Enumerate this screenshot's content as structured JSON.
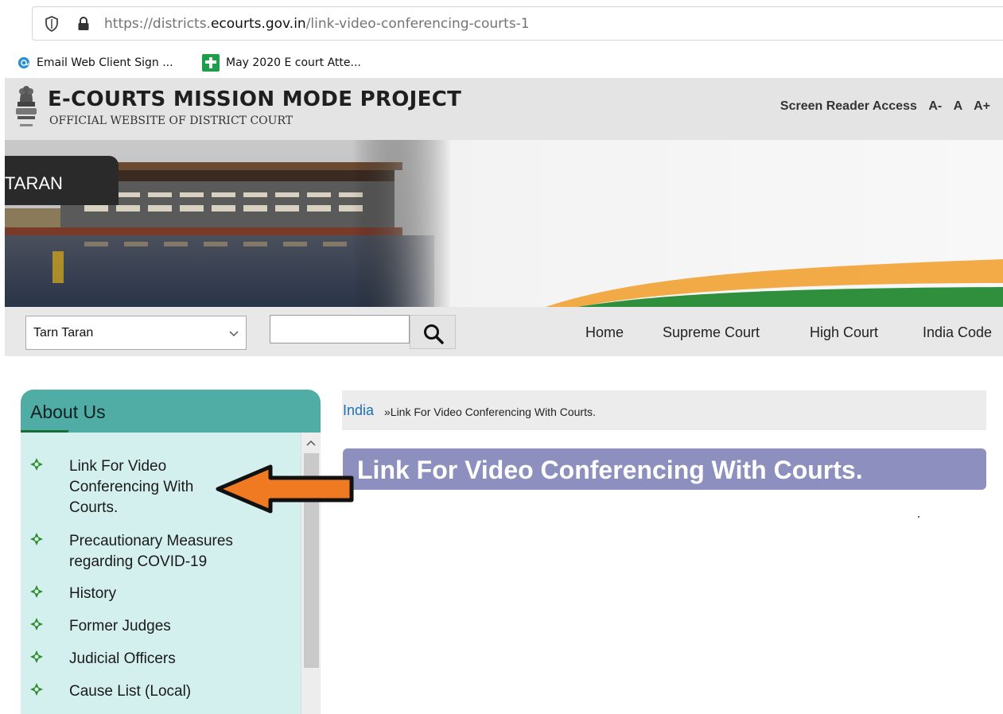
{
  "browser": {
    "url_prefix": "https://districts.",
    "url_domain": "ecourts.gov.in",
    "url_path": "/link-video-conferencing-courts-1",
    "bookmarks": [
      {
        "label": "Email Web Client Sign ...",
        "icon": "globe-mail-icon"
      },
      {
        "label": "May 2020 E court Atte...",
        "icon": "green-plus-icon"
      }
    ]
  },
  "header": {
    "title": "E-COURTS MISSION MODE PROJECT",
    "subtitle": "OFFICIAL WEBSITE OF DISTRICT COURT",
    "screen_reader": "Screen Reader Access",
    "font_sizes": [
      "A-",
      "A",
      "A+"
    ]
  },
  "banner": {
    "district_label": "TARAN"
  },
  "nav": {
    "district_selected": "Tarn Taran",
    "search_value": "",
    "links": [
      "Home",
      "Supreme Court",
      "High Court",
      "India Code"
    ]
  },
  "sidebar": {
    "title": "About Us",
    "items": [
      "Link For Video Conferencing With Courts.",
      "Precautionary Measures regarding COVID-19",
      "History",
      "Former Judges",
      "Judicial Officers",
      "Cause List (Local)"
    ]
  },
  "content": {
    "breadcrumb_home": "India",
    "breadcrumb_current": "»Link For Video Conferencing With Courts.",
    "heading": "Link For Video Conferencing With Courts."
  },
  "colors": {
    "sidebar_header": "#4fada6",
    "sidebar_body": "#d4f0ee",
    "heading_bg": "#8d8fbf",
    "arrow_fill": "#f07a22",
    "bullet_green": "#2e8b2e"
  }
}
